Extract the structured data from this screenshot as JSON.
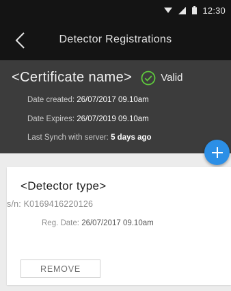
{
  "status_bar": {
    "time": "12:30",
    "icons": [
      "wifi-icon",
      "signal-icon",
      "battery-icon"
    ]
  },
  "app_bar": {
    "back_icon": "chevron-left-icon",
    "title": "Detector Registrations"
  },
  "certificate": {
    "name": "<Certificate name>",
    "status_icon": "check-circle-icon",
    "status": "Valid",
    "date_created_label": "Date created:",
    "date_created": "26/07/2017 09.10am",
    "date_expires_label": "Date Expires:",
    "date_expires": "26/07/2019 09.10am",
    "last_synch_label": "Last Synch with server:",
    "last_synch": "5 days ago"
  },
  "fab": {
    "icon": "plus-icon"
  },
  "detector": {
    "type": "<Detector type>",
    "sn_label": "s/n:",
    "sn": "K0169416220126",
    "reg_date_label": "Reg. Date:",
    "reg_date": "26/07/2017 09.10am",
    "remove_label": "REMOVE"
  },
  "colors": {
    "status_bar_bg": "#141414",
    "cert_panel_bg": "#3c3c3c",
    "valid_green": "#5fc93c",
    "fab_blue": "#2c8fe6",
    "page_bg": "#ececec"
  }
}
